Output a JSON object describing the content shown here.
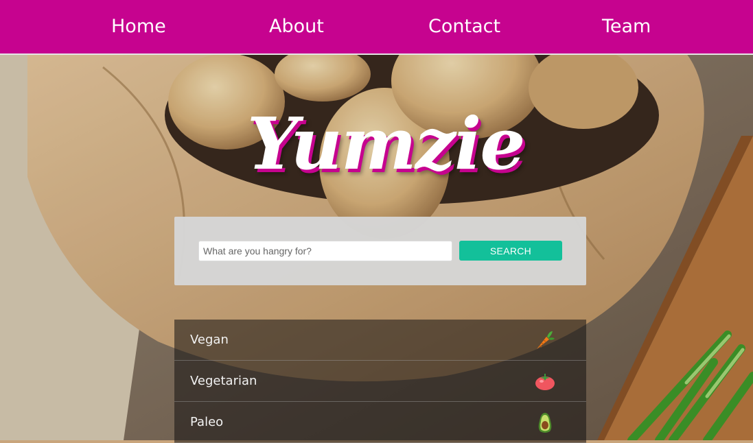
{
  "nav": {
    "items": [
      {
        "label": "Home"
      },
      {
        "label": "About"
      },
      {
        "label": "Contact"
      },
      {
        "label": "Team"
      }
    ]
  },
  "brand": {
    "logo_text": "Yumzie",
    "accent": "#c6038f"
  },
  "search": {
    "placeholder": "What are you hangry for?",
    "value": "",
    "button_label": "SEARCH",
    "button_color": "#13c09a"
  },
  "diets": [
    {
      "label": "Vegan",
      "icon": "carrot-icon"
    },
    {
      "label": "Vegetarian",
      "icon": "tomato-icon"
    },
    {
      "label": "Paleo",
      "icon": "avocado-icon"
    }
  ]
}
